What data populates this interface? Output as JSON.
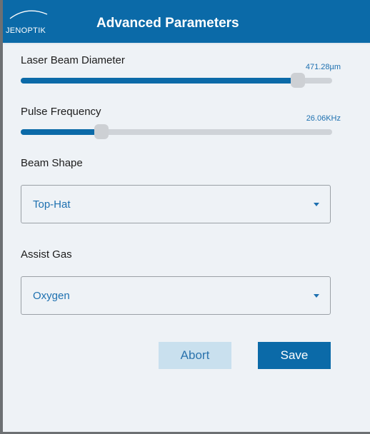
{
  "header": {
    "logo_text": "JENOPTIK",
    "title": "Advanced Parameters"
  },
  "colors": {
    "brand": "#0b6aa8",
    "accent_text": "#1d70b0",
    "background": "#eef2f6",
    "abort_bg": "#c9e0ee"
  },
  "params": {
    "beam_diameter": {
      "label": "Laser Beam Diameter",
      "value_text": "471.28µm",
      "fraction": 0.89
    },
    "pulse_frequency": {
      "label": "Pulse Frequency",
      "value_text": "26.06KHz",
      "fraction": 0.26
    },
    "beam_shape": {
      "label": "Beam Shape",
      "selected": "Top-Hat"
    },
    "assist_gas": {
      "label": "Assist Gas",
      "selected": "Oxygen"
    }
  },
  "actions": {
    "abort_label": "Abort",
    "save_label": "Save"
  }
}
